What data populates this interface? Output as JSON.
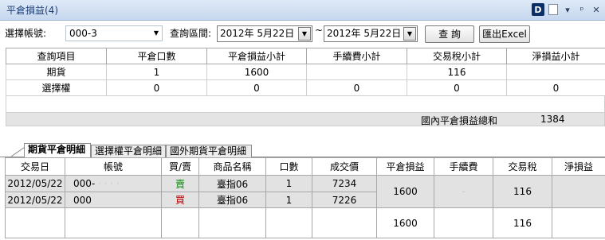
{
  "window": {
    "title": "平倉損益(4)",
    "d_button": "D"
  },
  "toolbar": {
    "account_label": "選擇帳號:",
    "account_value": "000-3",
    "range_label": "查詢區間:",
    "date_from": "2012年  5月22日",
    "tilde": "~",
    "date_to": "2012年  5月22日",
    "query_button": "查 詢",
    "export_button": "匯出Excel"
  },
  "summary": {
    "headers": [
      "查詢項目",
      "平倉口數",
      "平倉損益小計",
      "手續費小計",
      "交易稅小計",
      "淨損益小計"
    ],
    "rows": [
      [
        "期貨",
        "1",
        "1600",
        "",
        "116",
        ""
      ],
      [
        "選擇權",
        "0",
        "0",
        "0",
        "0",
        "0"
      ]
    ],
    "total_label": "國內平倉損益總和",
    "total_value": "1384"
  },
  "tabs": [
    "期貨平倉明細",
    "選擇權平倉明細",
    "國外期貨平倉明細"
  ],
  "detail": {
    "headers": [
      "交易日",
      "帳號",
      "買/賣",
      "商品名稱",
      "口數",
      "成交價",
      "平倉損益",
      "手續費",
      "交易稅",
      "淨損益"
    ],
    "rows": [
      {
        "date": "2012/05/22",
        "account": "000-",
        "side": "賣",
        "product": "臺指06",
        "qty": "1",
        "price": "7234"
      },
      {
        "date": "2012/05/22",
        "account": "000",
        "side": "買",
        "product": "臺指06",
        "qty": "1",
        "price": "7226"
      }
    ],
    "group_pnl": "1600",
    "group_fee": "-",
    "group_tax": "116",
    "total_pnl": "1600",
    "total_tax": "116"
  },
  "colors": {
    "title_text": "#1c3f78",
    "buy": "#c00000",
    "sell": "#0a8a0a"
  }
}
